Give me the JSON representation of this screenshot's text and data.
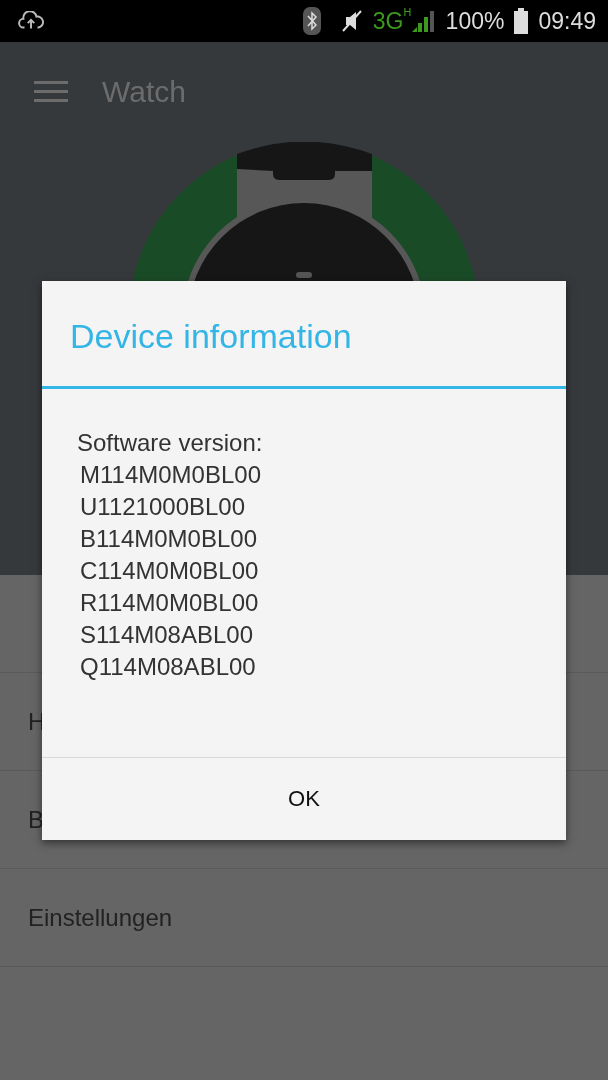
{
  "status_bar": {
    "network": "3G",
    "network_sub": "H",
    "battery": "100%",
    "time": "09:49"
  },
  "app_bar": {
    "title": "Watch"
  },
  "menu_items": [
    {
      "label": "H"
    },
    {
      "label": "B"
    },
    {
      "label": "Einstellungen"
    }
  ],
  "dialog": {
    "title": "Device information",
    "label": "Software version:",
    "versions": [
      "M114M0M0BL00",
      "U1121000BL00",
      "B114M0M0BL00",
      "C114M0M0BL00",
      "R114M0M0BL00",
      "S114M08ABL00",
      "Q114M08ABL00"
    ],
    "button": "OK"
  }
}
